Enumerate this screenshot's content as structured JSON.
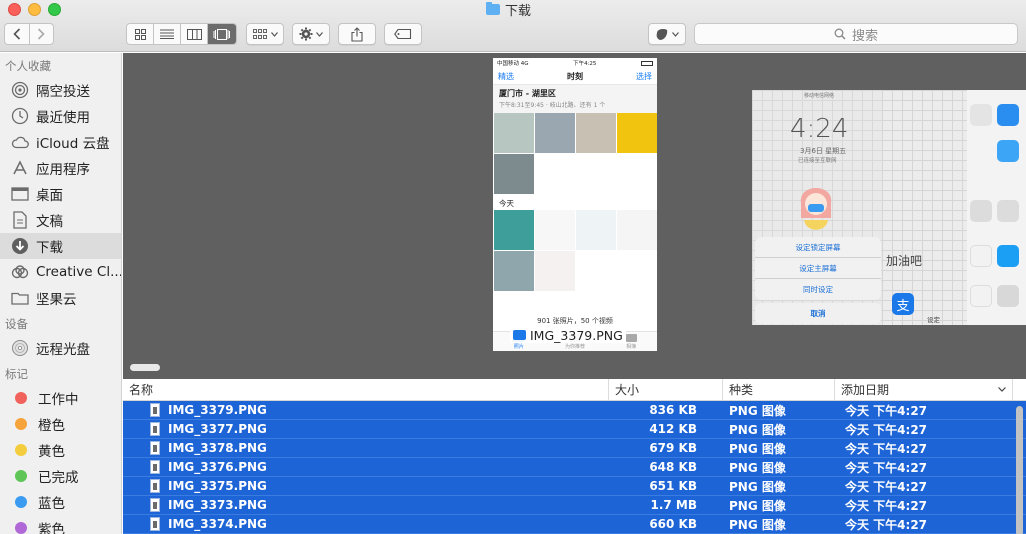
{
  "window": {
    "title": "下载"
  },
  "toolbar": {
    "search_placeholder": "搜索"
  },
  "sidebar": {
    "sections": [
      {
        "header": "个人收藏",
        "items": [
          {
            "label": "隔空投送",
            "icon": "airdrop-icon"
          },
          {
            "label": "最近使用",
            "icon": "clock-icon"
          },
          {
            "label": "iCloud 云盘",
            "icon": "cloud-icon"
          },
          {
            "label": "应用程序",
            "icon": "applications-icon"
          },
          {
            "label": "桌面",
            "icon": "desktop-icon"
          },
          {
            "label": "文稿",
            "icon": "document-icon"
          },
          {
            "label": "下载",
            "icon": "download-icon",
            "selected": true
          },
          {
            "label": "Creative Cl...",
            "icon": "creative-cloud-icon"
          },
          {
            "label": "坚果云",
            "icon": "folder-icon"
          }
        ]
      },
      {
        "header": "设备",
        "items": [
          {
            "label": "远程光盘",
            "icon": "disc-icon"
          }
        ]
      },
      {
        "header": "标记",
        "tags": [
          {
            "label": "工作中",
            "color": "#f0625b"
          },
          {
            "label": "橙色",
            "color": "#f5a33a"
          },
          {
            "label": "黄色",
            "color": "#f4cd3e"
          },
          {
            "label": "已完成",
            "color": "#5fc557"
          },
          {
            "label": "蓝色",
            "color": "#3b9bf0"
          },
          {
            "label": "紫色",
            "color": "#b069d6"
          }
        ]
      }
    ]
  },
  "preview": {
    "caption": "IMG_3379.PNG",
    "phone": {
      "carrier": "中国移动  4G",
      "time": "下午4:25",
      "back_label": "精选",
      "nav_title": "时刻",
      "select_label": "选择",
      "location_title": "厦门市 - 湖里区",
      "location_sub": "下午8:31至9:45 · 岐山北路、还有 1 个",
      "today_label": "今天",
      "count_text": "901 张照片，50 个视频",
      "tabs": [
        "照片",
        "为你推荐",
        "相簿"
      ]
    },
    "side": {
      "time": "4:24",
      "date": "3月6日 星期五",
      "sub": "已连接至互联网",
      "status": "移动电信网络",
      "actions": [
        "设定锁定屏幕",
        "设定主屏幕",
        "同时设定"
      ],
      "cancel": "取消",
      "wall_text": "加油吧",
      "settings_label": "设定"
    }
  },
  "list": {
    "columns": {
      "name": "名称",
      "size": "大小",
      "kind": "种类",
      "date": "添加日期"
    },
    "rows": [
      {
        "name": "IMG_3379.PNG",
        "size": "836 KB",
        "kind": "PNG 图像",
        "date": "今天 下午4:27"
      },
      {
        "name": "IMG_3377.PNG",
        "size": "412 KB",
        "kind": "PNG 图像",
        "date": "今天 下午4:27"
      },
      {
        "name": "IMG_3378.PNG",
        "size": "679 KB",
        "kind": "PNG 图像",
        "date": "今天 下午4:27"
      },
      {
        "name": "IMG_3376.PNG",
        "size": "648 KB",
        "kind": "PNG 图像",
        "date": "今天 下午4:27"
      },
      {
        "name": "IMG_3375.PNG",
        "size": "651 KB",
        "kind": "PNG 图像",
        "date": "今天 下午4:27"
      },
      {
        "name": "IMG_3373.PNG",
        "size": "1.7 MB",
        "kind": "PNG 图像",
        "date": "今天 下午4:27"
      },
      {
        "name": "IMG_3374.PNG",
        "size": "660 KB",
        "kind": "PNG 图像",
        "date": "今天 下午4:27"
      }
    ]
  }
}
